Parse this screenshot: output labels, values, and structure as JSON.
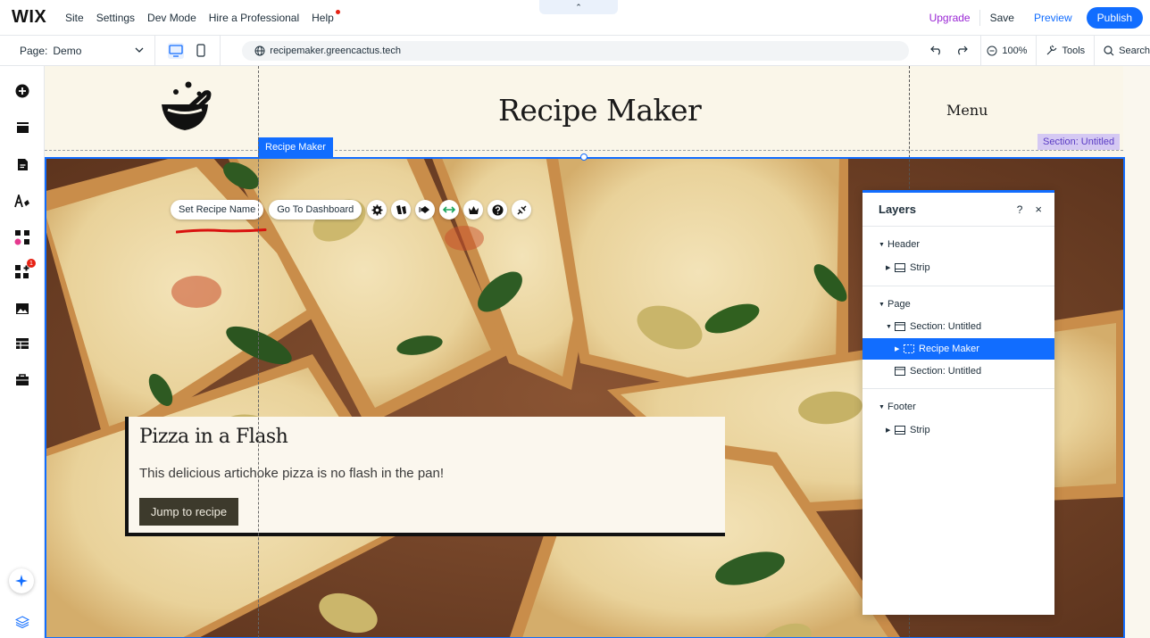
{
  "topbar": {
    "logo": "WIX",
    "menu": [
      "Site",
      "Settings",
      "Dev Mode",
      "Hire a Professional",
      "Help"
    ],
    "collapse_glyph": "⌃",
    "upgrade": "Upgrade",
    "save": "Save",
    "preview": "Preview",
    "publish": "Publish"
  },
  "secondbar": {
    "page_label": "Page:",
    "page_value": "Demo",
    "url": "recipemaker.greencactus.tech",
    "zoom": "100%",
    "tools": "Tools",
    "search": "Search"
  },
  "left_tools": [
    "add-elements-icon",
    "sections-icon",
    "pages-icon",
    "theme-icon",
    "apps-icon",
    "app-market-icon",
    "media-icon",
    "cms-icon",
    "business-icon",
    "ai-assistant-icon",
    "layers-icon"
  ],
  "left_badge": "1",
  "site": {
    "title": "Recipe Maker",
    "menu": "Menu",
    "section_tag": "Section: Untitled",
    "element_tag": "Recipe Maker"
  },
  "actions": {
    "set_name": "Set Recipe Name",
    "dashboard": "Go To Dashboard"
  },
  "card": {
    "title": "Pizza in a Flash",
    "text": "This delicious artichoke pizza is no flash in the pan!",
    "button": "Jump to recipe"
  },
  "layers": {
    "title": "Layers",
    "help": "?",
    "close": "×",
    "rows": [
      "Header",
      "Strip",
      "Page",
      "Section: Untitled",
      "Recipe Maker",
      "Section: Untitled",
      "Footer",
      "Strip"
    ]
  },
  "colors": {
    "accent": "#116dff",
    "upgrade": "#9a27d5",
    "section_tag_bg": "#d5c9f3"
  }
}
